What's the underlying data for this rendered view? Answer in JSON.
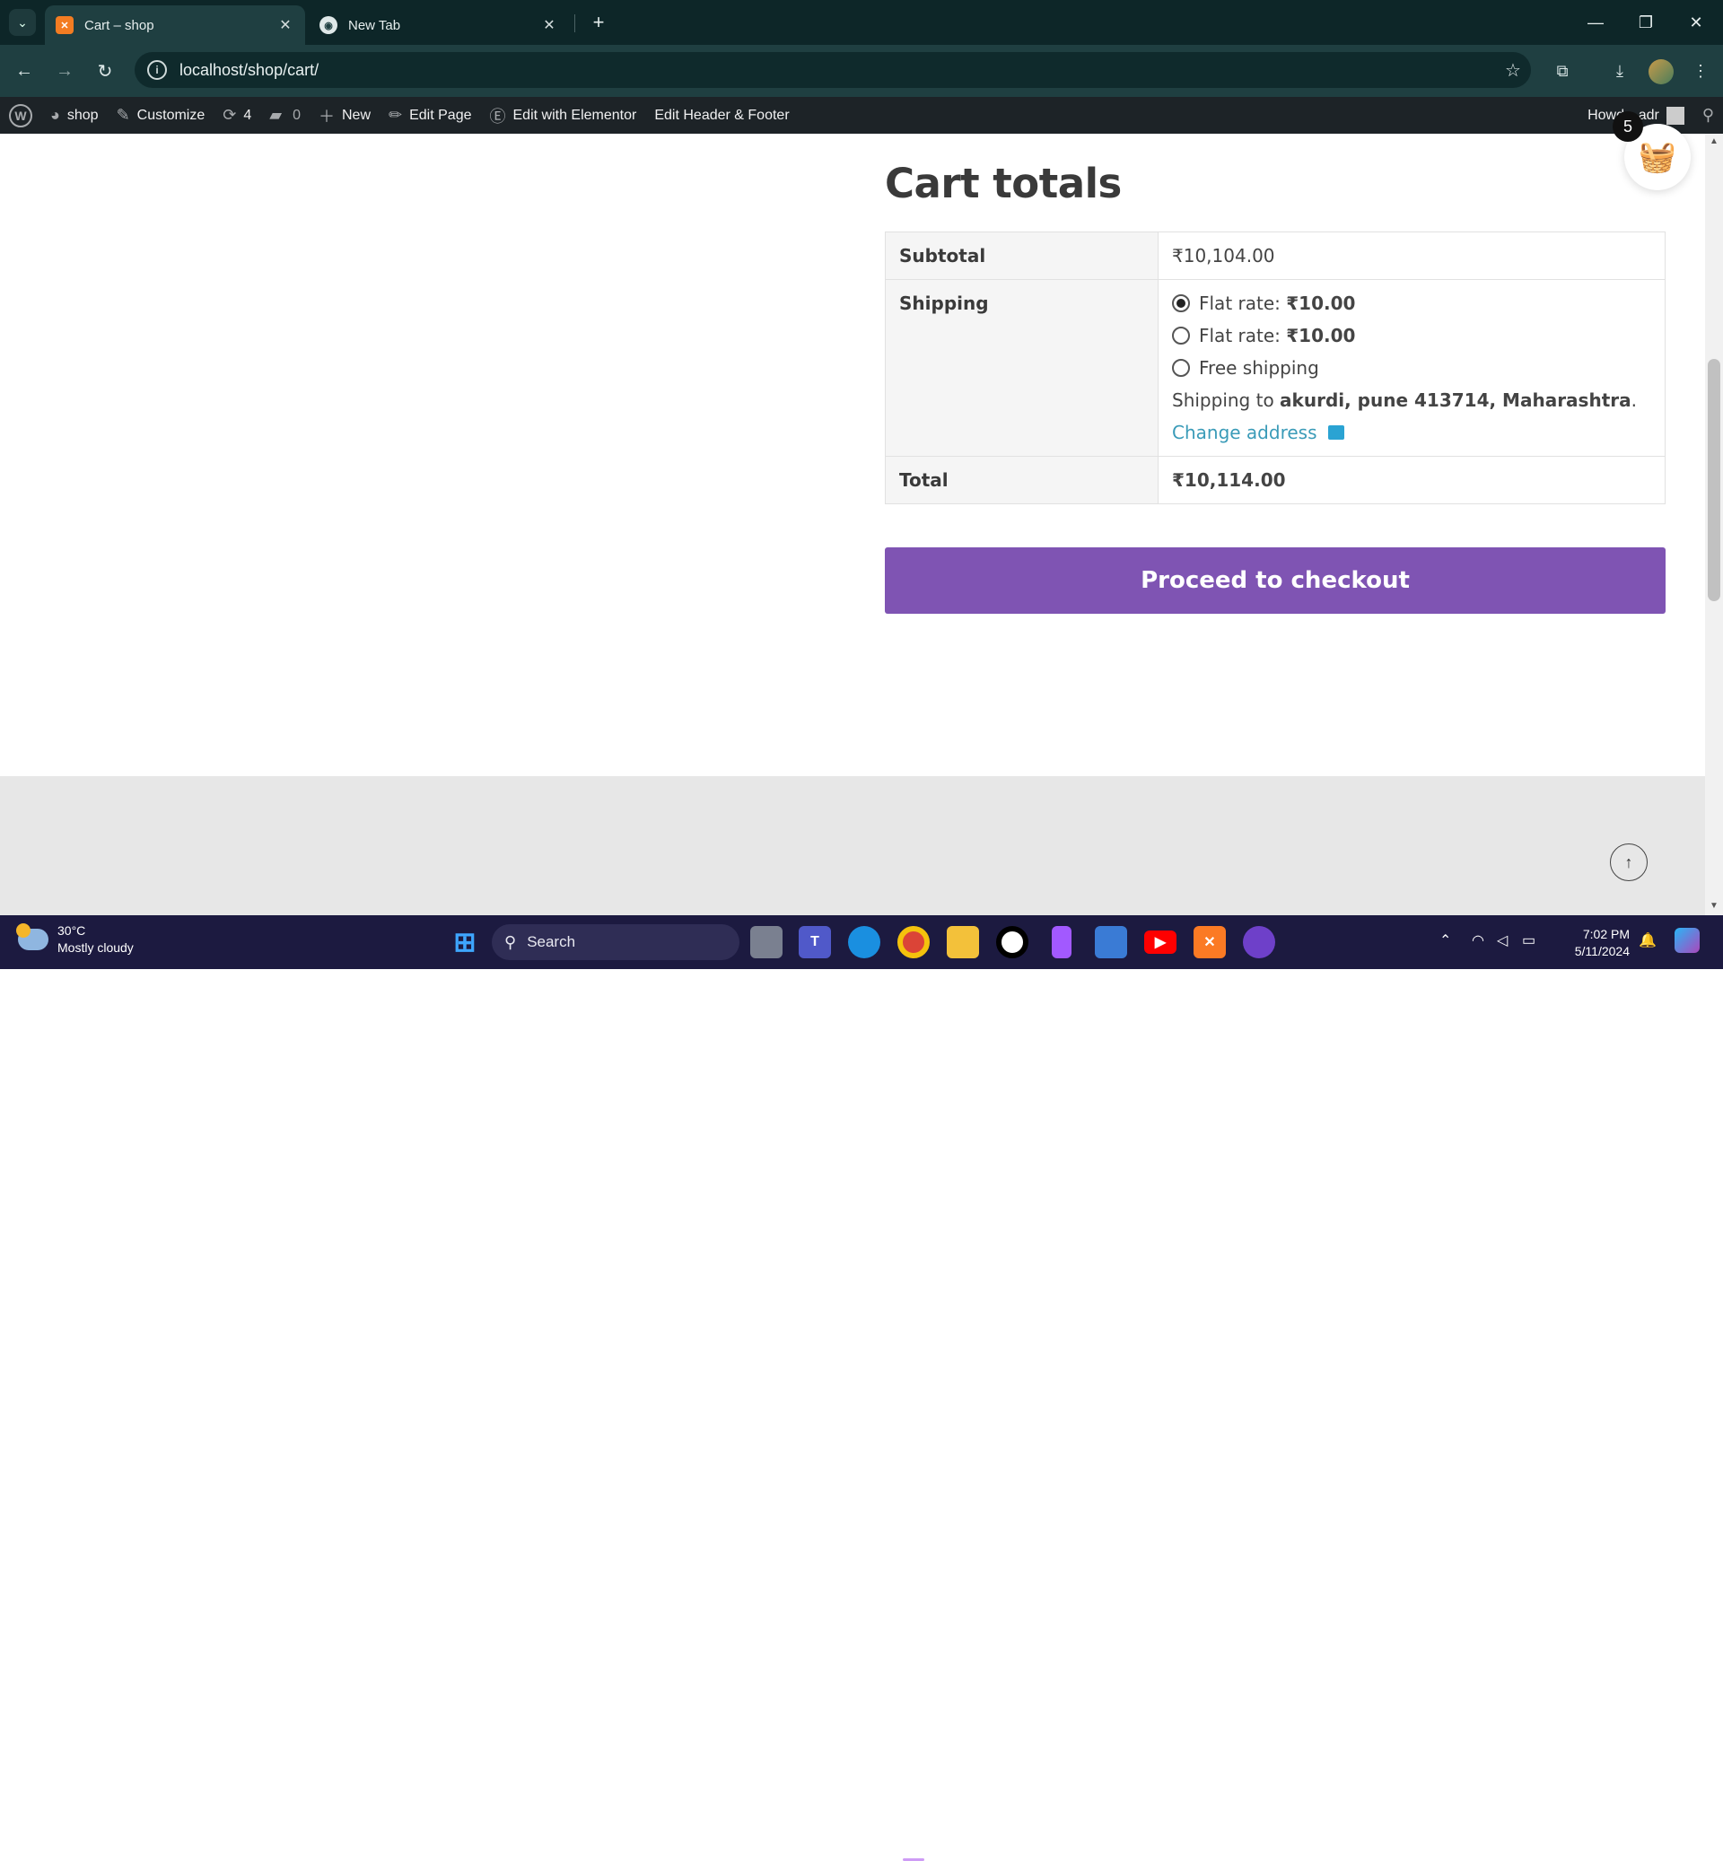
{
  "browser": {
    "tabs": [
      {
        "title": "Cart – shop",
        "active": true,
        "icon": "xampp-icon"
      },
      {
        "title": "New Tab",
        "active": false,
        "icon": "chrome-icon"
      }
    ],
    "url": "localhost/shop/cart/"
  },
  "adminbar": {
    "site": "shop",
    "customize": "Customize",
    "updates_count": "4",
    "comments_count": "0",
    "new": "New",
    "edit_page": "Edit Page",
    "elementor": "Edit with Elementor",
    "header_footer": "Edit Header & Footer",
    "howdy": "Howdy, adr"
  },
  "cart": {
    "heading": "Cart totals",
    "subtotal_label": "Subtotal",
    "subtotal_value": "₹10,104.00",
    "shipping_label": "Shipping",
    "shipping_options": [
      {
        "label": "Flat rate: ",
        "price": "₹10.00",
        "selected": true
      },
      {
        "label": "Flat rate: ",
        "price": "₹10.00",
        "selected": false
      },
      {
        "label": "Free shipping",
        "price": "",
        "selected": false
      }
    ],
    "shipping_to_prefix": "Shipping to ",
    "shipping_to_address": "akurdi, pune 413714, Maharashtra",
    "shipping_to_suffix": ".",
    "change_address": "Change address",
    "total_label": "Total",
    "total_value": "₹10,114.00",
    "checkout_button": "Proceed to checkout",
    "mini_cart_count": "5"
  },
  "taskbar": {
    "temperature": "30°C",
    "weather": "Mostly cloudy",
    "search_placeholder": "Search",
    "time": "7:02 PM",
    "date": "5/11/2024"
  },
  "colors": {
    "checkout_bg": "#7f54b3",
    "link": "#3a9bb8",
    "adminbar": "#1d2327",
    "chrome_frame": "#0d2628"
  }
}
